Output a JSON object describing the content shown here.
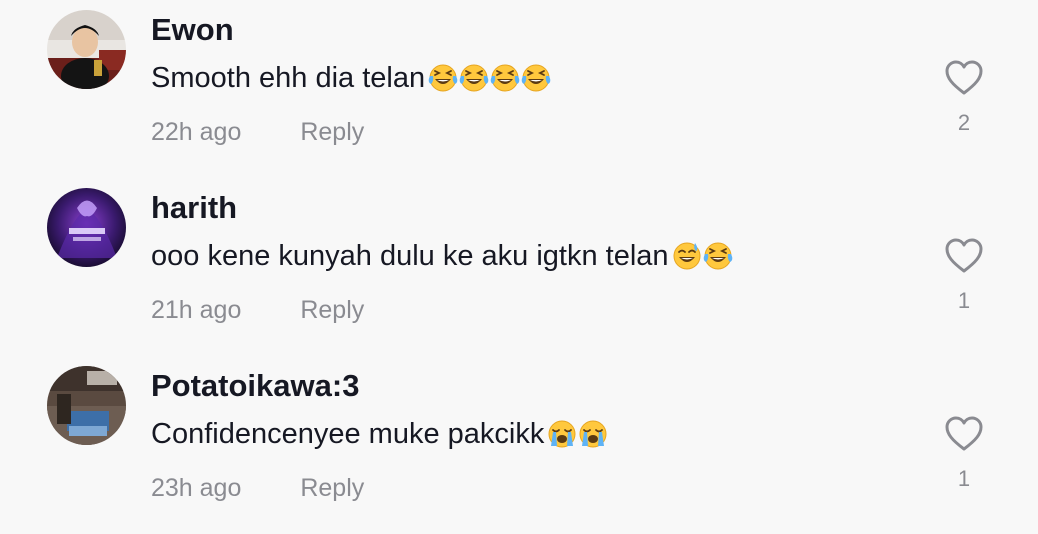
{
  "comments": [
    {
      "username": "Ewon",
      "text": "Smooth ehh dia telan",
      "emojis": [
        "laughing-tears",
        "laughing-tears",
        "laughing-tears",
        "laughing-tears"
      ],
      "time": "22h ago",
      "reply_label": "Reply",
      "likes": "2"
    },
    {
      "username": "harith",
      "text": "ooo kene kunyah dulu ke aku igtkn telan ",
      "emojis": [
        "grin-sweat",
        "laughing-tears"
      ],
      "time": "21h ago",
      "reply_label": "Reply",
      "likes": "1"
    },
    {
      "username": "Potatoikawa:3",
      "text": "Confidencenyee muke pakcikk",
      "emojis": [
        "loudly-crying",
        "loudly-crying"
      ],
      "time": "23h ago",
      "reply_label": "Reply",
      "likes": "1"
    }
  ],
  "colors": {
    "background": "#f8f8f8",
    "text_primary": "#161823",
    "text_secondary": "#8a8b91",
    "emoji_yellow": "#ffc83d",
    "emoji_tears": "#5fb3f5"
  },
  "icons": {
    "like": "heart-outline-icon"
  }
}
